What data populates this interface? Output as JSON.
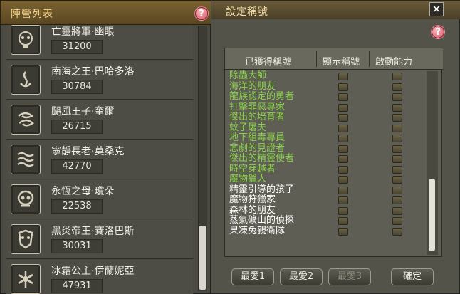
{
  "left_panel": {
    "title": "陣營列表",
    "help_symbol": "?",
    "factions": [
      {
        "name": "亡靈將軍·幽眼",
        "score": "31200",
        "icon": "skull-knight-emblem-icon"
      },
      {
        "name": "南海之王·巴哈多洛",
        "score": "30784",
        "icon": "sea-flame-emblem-icon"
      },
      {
        "name": "颶風王子·奎爾",
        "score": "26715",
        "icon": "wind-swirl-emblem-icon"
      },
      {
        "name": "寧靜長老·莫桑克",
        "score": "42770",
        "icon": "wave-scroll-emblem-icon"
      },
      {
        "name": "永恆之母·瓊朵",
        "score": "22538",
        "icon": "skull-mother-emblem-icon"
      },
      {
        "name": "黑炎帝王·賽洛巴斯",
        "score": "30031",
        "icon": "dark-flame-mask-emblem-icon"
      },
      {
        "name": "冰霜公主·伊蘭妮亞",
        "score": "47931",
        "icon": "ice-crystal-emblem-icon"
      }
    ]
  },
  "right_panel": {
    "title": "設定稱號",
    "close_symbol": "✕",
    "help_symbol": "?",
    "columns": [
      "已獲得稱號",
      "顯示稱號",
      "啟動能力"
    ],
    "titles": [
      {
        "name": "除蟲大師",
        "color": "#8ad24b"
      },
      {
        "name": "海洋的朋友",
        "color": "#8ad24b"
      },
      {
        "name": "龍族認定的勇者",
        "color": "#8ad24b"
      },
      {
        "name": "打擊罪惡專家",
        "color": "#8ad24b"
      },
      {
        "name": "傑出的培育者",
        "color": "#8ad24b"
      },
      {
        "name": "蚊子屠夫",
        "color": "#8ad24b"
      },
      {
        "name": "地下組毒專員",
        "color": "#8ad24b"
      },
      {
        "name": "悲劇的見證者",
        "color": "#8ad24b"
      },
      {
        "name": "傑出的精靈使者",
        "color": "#8ad24b"
      },
      {
        "name": "時空穿越者",
        "color": "#8ad24b"
      },
      {
        "name": "魔物獵人",
        "color": "#8ad24b"
      },
      {
        "name": "精靈引導的孩子",
        "color": "#ffffff"
      },
      {
        "name": "魔物狩獵家",
        "color": "#ffffff"
      },
      {
        "name": "森林的朋友",
        "color": "#ffffff"
      },
      {
        "name": "蒸氣礦山的偵探",
        "color": "#ffffff"
      },
      {
        "name": "果凍兔親衛隊",
        "color": "#ffffff"
      }
    ],
    "buttons": {
      "fav1": "最愛1",
      "fav2": "最愛2",
      "fav3": "最愛3",
      "confirm": "確定"
    }
  }
}
